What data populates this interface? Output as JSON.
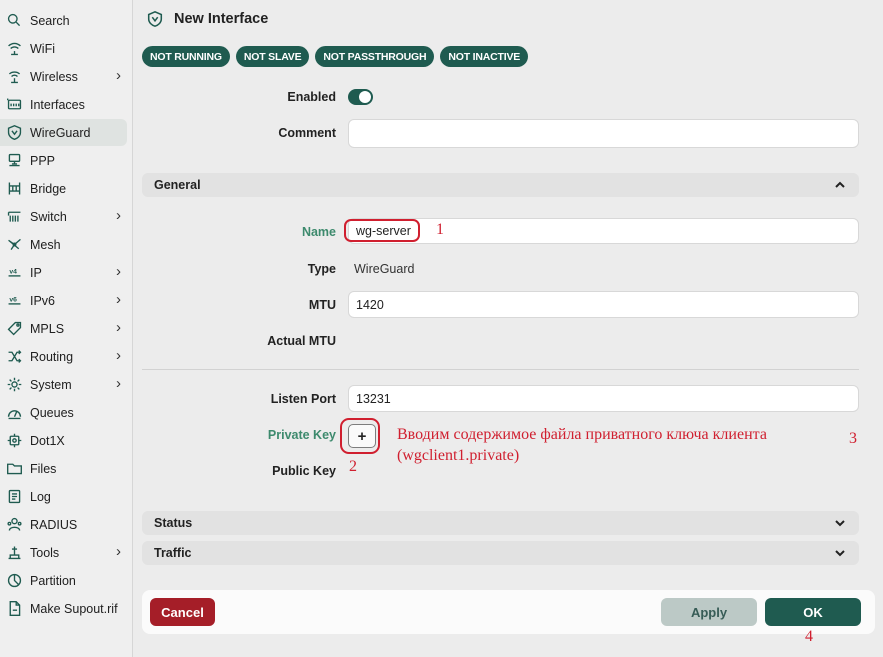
{
  "sidebar": {
    "items": [
      {
        "label": "Search",
        "icon": "search-icon",
        "chevron": false,
        "active": false
      },
      {
        "label": "WiFi",
        "icon": "wifi-icon",
        "chevron": false,
        "active": false
      },
      {
        "label": "Wireless",
        "icon": "wireless-icon",
        "chevron": true,
        "active": false
      },
      {
        "label": "Interfaces",
        "icon": "interfaces-icon",
        "chevron": false,
        "active": false
      },
      {
        "label": "WireGuard",
        "icon": "wireguard-shield-icon",
        "chevron": false,
        "active": true
      },
      {
        "label": "PPP",
        "icon": "ppp-icon",
        "chevron": false,
        "active": false
      },
      {
        "label": "Bridge",
        "icon": "bridge-icon",
        "chevron": false,
        "active": false
      },
      {
        "label": "Switch",
        "icon": "switch-icon",
        "chevron": true,
        "active": false
      },
      {
        "label": "Mesh",
        "icon": "mesh-icon",
        "chevron": false,
        "active": false
      },
      {
        "label": "IP",
        "icon": "ipv4-icon",
        "chevron": true,
        "active": false
      },
      {
        "label": "IPv6",
        "icon": "ipv6-icon",
        "chevron": true,
        "active": false
      },
      {
        "label": "MPLS",
        "icon": "mpls-tag-icon",
        "chevron": true,
        "active": false
      },
      {
        "label": "Routing",
        "icon": "routing-icon",
        "chevron": true,
        "active": false
      },
      {
        "label": "System",
        "icon": "gear-icon",
        "chevron": true,
        "active": false
      },
      {
        "label": "Queues",
        "icon": "queues-gauge-icon",
        "chevron": false,
        "active": false
      },
      {
        "label": "Dot1X",
        "icon": "dot1x-icon",
        "chevron": false,
        "active": false
      },
      {
        "label": "Files",
        "icon": "folder-icon",
        "chevron": false,
        "active": false
      },
      {
        "label": "Log",
        "icon": "log-icon",
        "chevron": false,
        "active": false
      },
      {
        "label": "RADIUS",
        "icon": "radius-icon",
        "chevron": false,
        "active": false
      },
      {
        "label": "Tools",
        "icon": "tools-icon",
        "chevron": true,
        "active": false
      },
      {
        "label": "Partition",
        "icon": "partition-icon",
        "chevron": false,
        "active": false
      },
      {
        "label": "Make Supout.rif",
        "icon": "supout-file-icon",
        "chevron": false,
        "active": false
      }
    ]
  },
  "header": {
    "title": "New Interface",
    "icon": "wireguard-shield-icon"
  },
  "badges": [
    "NOT RUNNING",
    "NOT SLAVE",
    "NOT PASSTHROUGH",
    "NOT INACTIVE"
  ],
  "form": {
    "enabled_label": "Enabled",
    "enabled_value": true,
    "comment_label": "Comment",
    "comment_value": "",
    "general_section": "General",
    "name_label": "Name",
    "name_value": "wg-server",
    "type_label": "Type",
    "type_value": "WireGuard",
    "mtu_label": "MTU",
    "mtu_value": "1420",
    "actual_mtu_label": "Actual MTU",
    "listen_port_label": "Listen Port",
    "listen_port_value": "13231",
    "private_key_label": "Private Key",
    "private_key_button": "+",
    "public_key_label": "Public Key",
    "status_section": "Status",
    "traffic_section": "Traffic"
  },
  "annotations": {
    "n1": "1",
    "n2": "2",
    "n3": "3",
    "n4": "4",
    "note_line1": "Вводим содержимое файла приватного ключа клиента",
    "note_line2": "(wgclient1.private)"
  },
  "footer": {
    "cancel": "Cancel",
    "apply": "Apply",
    "ok": "OK"
  },
  "colors": {
    "accent": "#1f5b50",
    "danger": "#a51e28",
    "annotation": "#d01f2f",
    "label_green": "#3d8a6d"
  }
}
